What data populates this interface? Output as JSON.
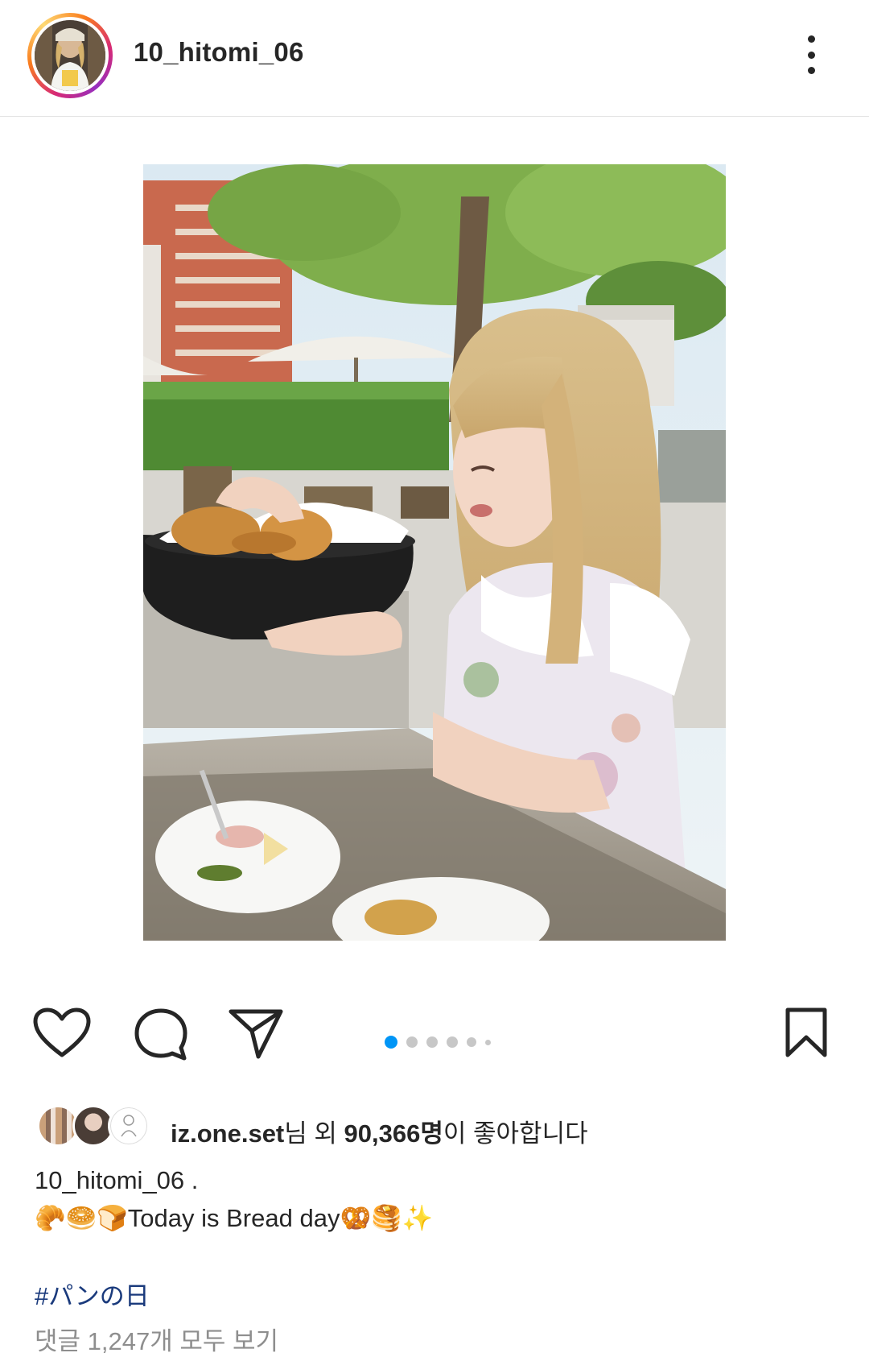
{
  "post": {
    "username": "10_hitomi_06",
    "photo_alt": "Woman with long blonde hair holding a black bowl of croissants at an outdoor cafe table",
    "carousel": {
      "count": 6,
      "active_index": 0
    },
    "likes": {
      "liked_by": "iz.one.set",
      "suffix1": "님 외 ",
      "count": "90,366명",
      "suffix2": "이 좋아합니다"
    },
    "caption": {
      "username": "10_hitomi_06",
      "username_suffix": " .",
      "text": "🥐🥯🍞Today is Bread day🥨🥞✨"
    },
    "hashtag": "#パンの日",
    "view_comments": "댓글 1,247개 모두 보기"
  },
  "icons": {
    "more": "more-vertical-icon",
    "like": "heart-icon",
    "comment": "comment-bubble-icon",
    "share": "paper-plane-icon",
    "save": "bookmark-icon"
  },
  "colors": {
    "accent": "#0095f6",
    "text": "#262626",
    "muted": "#8e8e8e",
    "hashtag": "#1a3a7c"
  }
}
